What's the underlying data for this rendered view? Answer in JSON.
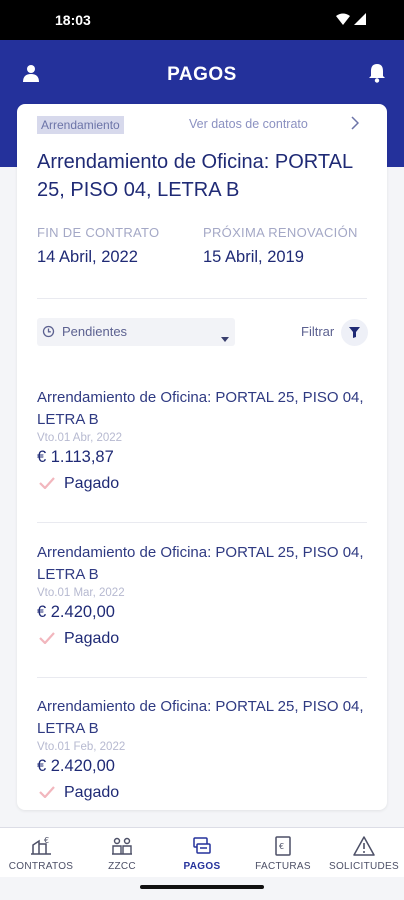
{
  "status_bar": {
    "time": "18:03"
  },
  "header": {
    "title": "PAGOS"
  },
  "contract": {
    "tag": "Arrendamiento",
    "details_link": "Ver datos de contrato",
    "title": "Arrendamiento de Oficina: PORTAL 25, PISO 04, LETRA B",
    "end_label": "FIN DE CONTRATO",
    "end_value": "14 Abril, 2022",
    "renewal_label": "PRÓXIMA RENOVACIÓN",
    "renewal_value": "15 Abril, 2019"
  },
  "filters": {
    "selected": "Pendientes",
    "filter_label": "Filtrar"
  },
  "payments": [
    {
      "description": "Arrendamiento de Oficina: PORTAL 25, PISO 04, LETRA B",
      "due": "Vto.01 Abr, 2022",
      "amount": "€ 1.113,87",
      "status": "Pagado"
    },
    {
      "description": "Arrendamiento de Oficina: PORTAL 25, PISO 04, LETRA B",
      "due": "Vto.01 Mar, 2022",
      "amount": "€ 2.420,00",
      "status": "Pagado"
    },
    {
      "description": "Arrendamiento de Oficina: PORTAL 25, PISO 04, LETRA B",
      "due": "Vto.01 Feb, 2022",
      "amount": "€ 2.420,00",
      "status": "Pagado"
    }
  ],
  "nav": [
    {
      "label": "CONTRATOS",
      "icon": "contracts-icon"
    },
    {
      "label": "ZZCC",
      "icon": "common-areas-icon"
    },
    {
      "label": "PAGOS",
      "icon": "payments-icon",
      "active": true
    },
    {
      "label": "FACTURAS",
      "icon": "invoices-icon"
    },
    {
      "label": "SOLICITUDES",
      "icon": "warning-icon"
    }
  ],
  "colors": {
    "primary": "#24319b",
    "text": "#1f2a75",
    "check": "#f2b6bd"
  }
}
